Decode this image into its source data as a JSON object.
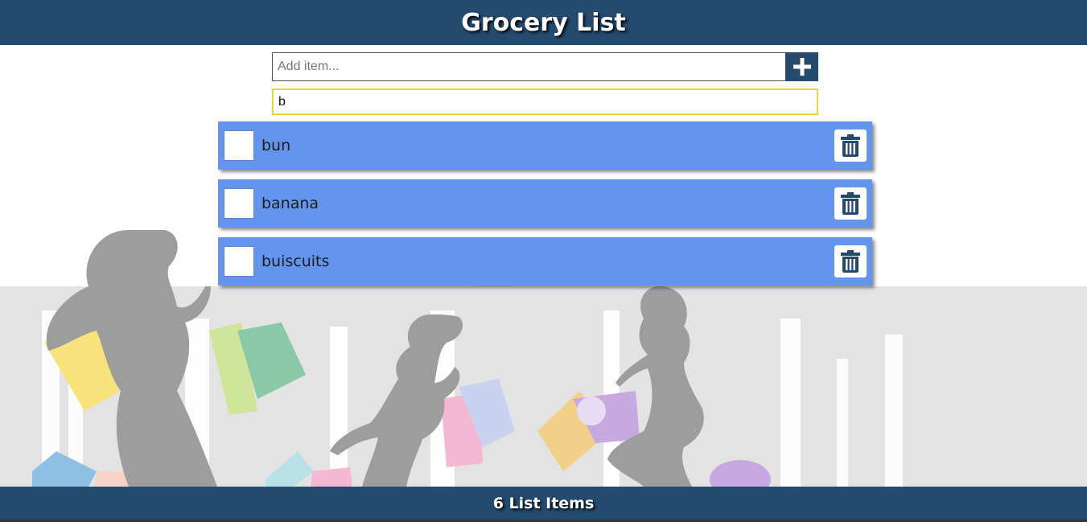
{
  "header": {
    "title": "Grocery List"
  },
  "add_form": {
    "placeholder": "Add item...",
    "value": ""
  },
  "search": {
    "value": "b"
  },
  "items": [
    {
      "label": "bun",
      "checked": false
    },
    {
      "label": "banana",
      "checked": false
    },
    {
      "label": "buiscuits",
      "checked": false
    }
  ],
  "footer": {
    "count_text": "6 List Items"
  },
  "colors": {
    "header_bg": "#254a70",
    "item_bg": "#6495ed",
    "search_border": "#f3d23c",
    "silhouette": "#9e9e9e",
    "skyline": "#e2e2e2"
  },
  "icons": {
    "add": "plus-icon",
    "delete": "trash-icon"
  }
}
